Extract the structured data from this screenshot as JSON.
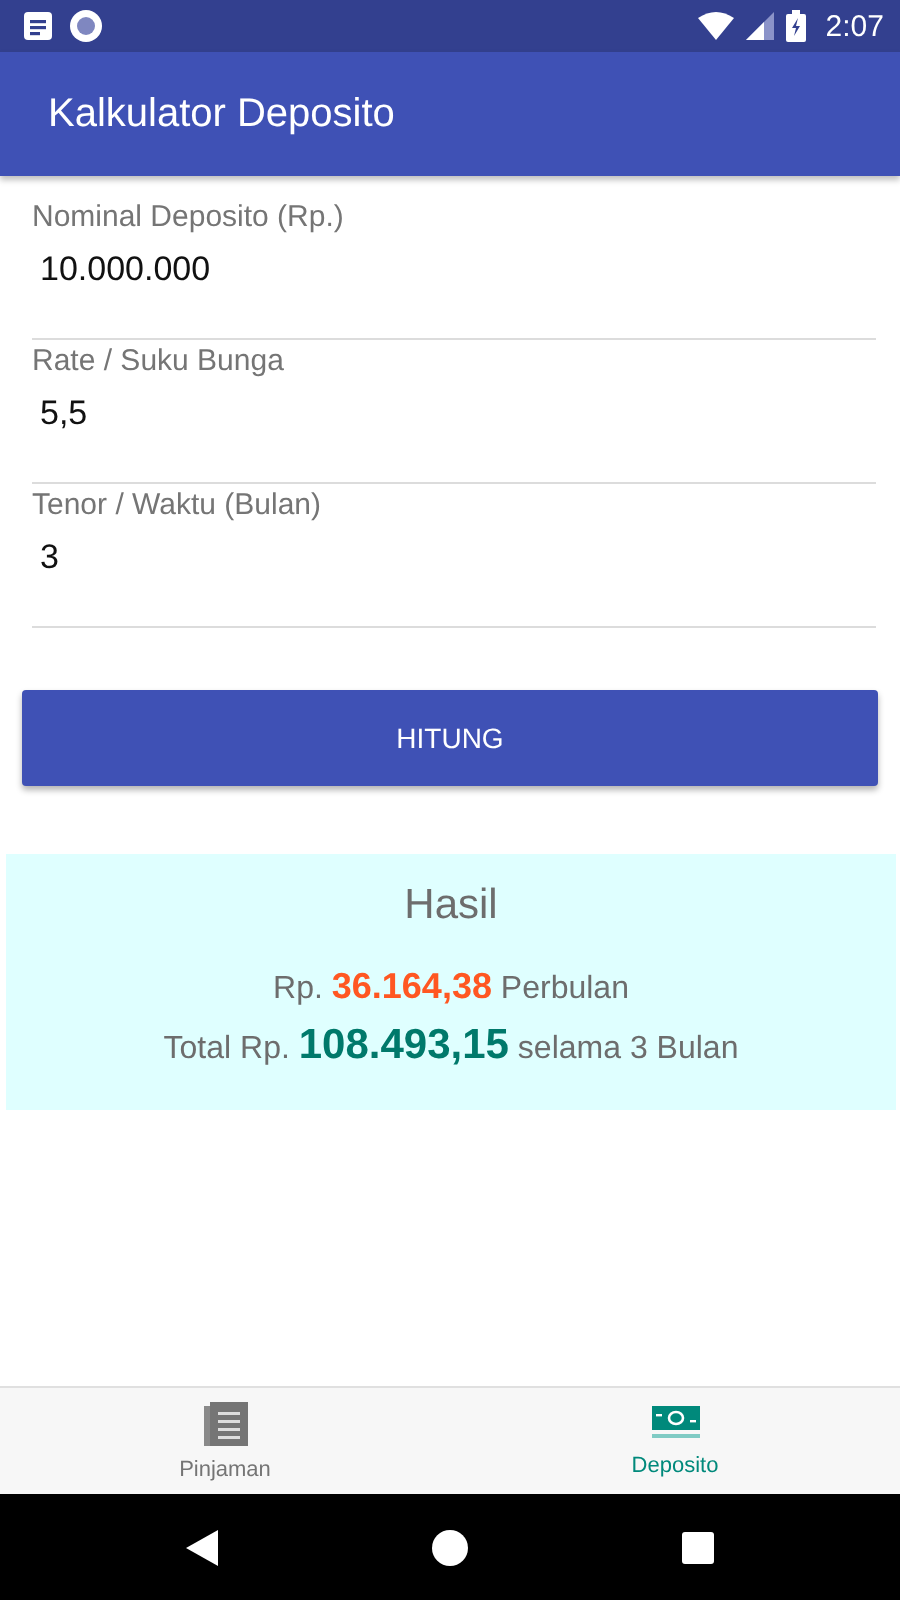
{
  "status_bar": {
    "time": "2:07"
  },
  "app_bar": {
    "title": "Kalkulator Deposito"
  },
  "fields": [
    {
      "label": "Nominal Deposito (Rp.)",
      "value": "10.000.000"
    },
    {
      "label": "Rate / Suku Bunga",
      "value": "5,5"
    },
    {
      "label": "Tenor / Waktu (Bulan)",
      "value": "3"
    }
  ],
  "button": {
    "label": "HITUNG"
  },
  "result": {
    "title": "Hasil",
    "lines": [
      {
        "prefix": "Rp.",
        "amount": "36.164,38",
        "suffix": "Perbulan"
      },
      {
        "prefix": "Total Rp.",
        "amount": "108.493,15",
        "suffix": "selama 3 Bulan"
      }
    ]
  },
  "bottom_nav": [
    {
      "label": "Pinjaman",
      "kind": "list",
      "selected": false
    },
    {
      "label": "Deposito",
      "kind": "money",
      "selected": true
    }
  ]
}
